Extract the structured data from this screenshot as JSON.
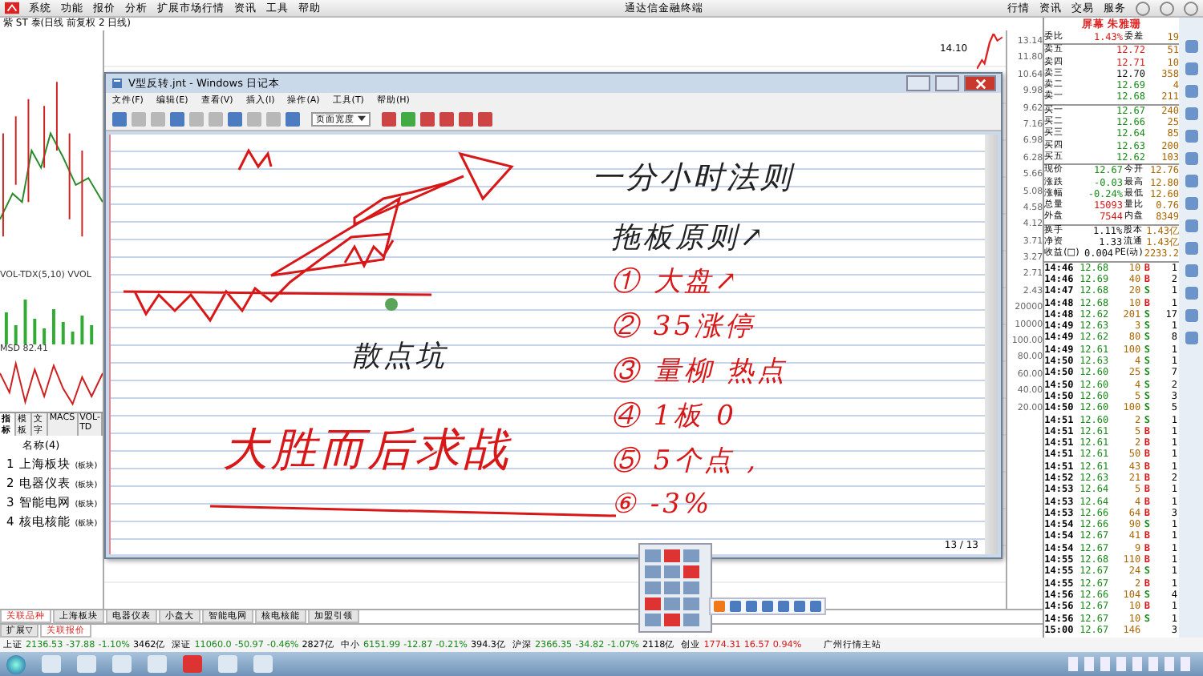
{
  "app": {
    "menu": [
      "系统",
      "功能",
      "报价",
      "分析",
      "扩展市场行情",
      "资讯",
      "工具",
      "帮助"
    ],
    "title": "通达信金融终端",
    "top_tabs": [
      "行情",
      "资讯",
      "交易",
      "服务"
    ],
    "chart_title": "紫 ST 泰(日线 前复权 2 日线)"
  },
  "chart": {
    "indicator_labels": [
      "VOL-TDX(5,10) VVOL",
      "MSD 82.41"
    ],
    "price_tag": "14.10",
    "axis_labels": [
      "13.14",
      "11.80",
      "10.64",
      "9.98",
      "9.62",
      "7.16",
      "6.98",
      "6.28",
      "5.66",
      "5.08",
      "4.58",
      "4.12",
      "3.71",
      "3.27",
      "2.71",
      "2.43",
      "20000",
      "10000",
      "100.00",
      "80.00",
      "60.00",
      "40.00",
      "20.00"
    ]
  },
  "left_panel": {
    "tabs": [
      {
        "label": "指标",
        "selected": true
      },
      {
        "label": "模板",
        "selected": false
      },
      {
        "label": "文字",
        "selected": false
      },
      {
        "label": "MACS",
        "selected": false
      },
      {
        "label": "VOL-TD",
        "selected": false
      }
    ],
    "header": "名称(4)",
    "items": [
      {
        "index": "1",
        "name": "上海板块",
        "tag": "(板块)"
      },
      {
        "index": "2",
        "name": "电器仪表",
        "tag": "(板块)"
      },
      {
        "index": "3",
        "name": "智能电网",
        "tag": "(板块)"
      },
      {
        "index": "4",
        "name": "核电核能",
        "tag": "(板块)"
      }
    ]
  },
  "bottom_tabs": [
    {
      "label": "关联品种",
      "selected": true
    },
    {
      "label": "上海板块",
      "selected": false
    },
    {
      "label": "电器仪表",
      "selected": false
    },
    {
      "label": "小盘大",
      "selected": false
    },
    {
      "label": "智能电网",
      "selected": false
    },
    {
      "label": "核电核能",
      "selected": false
    },
    {
      "label": "加盟引领",
      "selected": false
    }
  ],
  "sub_tabs": [
    {
      "label": "扩展▽",
      "selected": false
    },
    {
      "label": "关联报价",
      "selected": true
    }
  ],
  "quote_panel": {
    "title": "屏幕 朱雅珊",
    "book": [
      {
        "label": "委比",
        "value": "1.43%",
        "color": "#d81818",
        "label2": "委差",
        "value2": "19"
      },
      {
        "label": "卖五",
        "value": "12.72",
        "color": "#d81818",
        "value2": "51"
      },
      {
        "label": "卖四",
        "value": "12.71",
        "color": "#d81818",
        "value2": "10"
      },
      {
        "label": "卖三",
        "value": "12.70",
        "color": "#111111",
        "value2": "358"
      },
      {
        "label": "卖二",
        "value": "12.69",
        "color": "#1a8a1a",
        "value2": "4"
      },
      {
        "label": "卖一",
        "value": "12.68",
        "color": "#1a8a1a",
        "value2": "211"
      },
      {
        "label": "买一",
        "value": "12.67",
        "color": "#1a8a1a",
        "value2": "240"
      },
      {
        "label": "买二",
        "value": "12.66",
        "color": "#1a8a1a",
        "value2": "25"
      },
      {
        "label": "买三",
        "value": "12.64",
        "color": "#1a8a1a",
        "value2": "85"
      },
      {
        "label": "买四",
        "value": "12.63",
        "color": "#1a8a1a",
        "value2": "200"
      },
      {
        "label": "买五",
        "value": "12.62",
        "color": "#1a8a1a",
        "value2": "103"
      },
      {
        "label": "现价",
        "value": "12.67",
        "color": "#1a8a1a",
        "label2": "今开",
        "value2": "12.76"
      },
      {
        "label": "涨跌",
        "value": "-0.03",
        "color": "#1a8a1a",
        "label2": "最高",
        "value2": "12.80"
      },
      {
        "label": "涨幅",
        "value": "-0.24%",
        "color": "#1a8a1a",
        "label2": "最低",
        "value2": "12.60"
      },
      {
        "label": "总量",
        "value": "15093",
        "color": "#d81818",
        "label2": "量比",
        "value2": "0.76"
      },
      {
        "label": "外盘",
        "value": "7544",
        "color": "#d81818",
        "label2": "内盘",
        "value2": "8349"
      },
      {
        "label": "换手",
        "value": "1.11%",
        "color": "#111111",
        "label2": "股本",
        "value2": "1.43亿"
      },
      {
        "label": "净资",
        "value": "1.33",
        "color": "#111111",
        "label2": "流通",
        "value2": "1.43亿"
      },
      {
        "label": "收益(□)",
        "value": "0.004",
        "color": "#111111",
        "label2": "PE(动)",
        "value2": "2233.2"
      }
    ],
    "ticks": [
      {
        "time": "14:46",
        "price": "12.68",
        "volume": "10",
        "side": "B",
        "count": "1"
      },
      {
        "time": "14:46",
        "price": "12.69",
        "volume": "40",
        "side": "B",
        "count": "2"
      },
      {
        "time": "14:47",
        "price": "12.68",
        "volume": "20",
        "side": "S",
        "count": "1"
      },
      {
        "time": "14:48",
        "price": "12.68",
        "volume": "10",
        "side": "B",
        "count": "1"
      },
      {
        "time": "14:48",
        "price": "12.62",
        "volume": "201",
        "side": "S",
        "count": "17"
      },
      {
        "time": "14:49",
        "price": "12.63",
        "volume": "3",
        "side": "S",
        "count": "1"
      },
      {
        "time": "14:49",
        "price": "12.62",
        "volume": "80",
        "side": "S",
        "count": "8"
      },
      {
        "time": "14:49",
        "price": "12.61",
        "volume": "100",
        "side": "S",
        "count": "1"
      },
      {
        "time": "14:50",
        "price": "12.63",
        "volume": "4",
        "side": "S",
        "count": "1"
      },
      {
        "time": "14:50",
        "price": "12.60",
        "volume": "25",
        "side": "S",
        "count": "7"
      },
      {
        "time": "14:50",
        "price": "12.60",
        "volume": "4",
        "side": "S",
        "count": "2"
      },
      {
        "time": "14:50",
        "price": "12.60",
        "volume": "5",
        "side": "S",
        "count": "3"
      },
      {
        "time": "14:50",
        "price": "12.60",
        "volume": "100",
        "side": "S",
        "count": "5"
      },
      {
        "time": "14:51",
        "price": "12.60",
        "volume": "2",
        "side": "S",
        "count": "1"
      },
      {
        "time": "14:51",
        "price": "12.61",
        "volume": "5",
        "side": "B",
        "count": "1"
      },
      {
        "time": "14:51",
        "price": "12.61",
        "volume": "2",
        "side": "B",
        "count": "1"
      },
      {
        "time": "14:51",
        "price": "12.61",
        "volume": "50",
        "side": "B",
        "count": "1"
      },
      {
        "time": "14:51",
        "price": "12.61",
        "volume": "43",
        "side": "B",
        "count": "1"
      },
      {
        "time": "14:52",
        "price": "12.63",
        "volume": "21",
        "side": "B",
        "count": "2"
      },
      {
        "time": "14:53",
        "price": "12.64",
        "volume": "5",
        "side": "B",
        "count": "1"
      },
      {
        "time": "14:53",
        "price": "12.64",
        "volume": "4",
        "side": "B",
        "count": "1"
      },
      {
        "time": "14:53",
        "price": "12.66",
        "volume": "64",
        "side": "B",
        "count": "3"
      },
      {
        "time": "14:54",
        "price": "12.66",
        "volume": "90",
        "side": "S",
        "count": "1"
      },
      {
        "time": "14:54",
        "price": "12.67",
        "volume": "41",
        "side": "B",
        "count": "1"
      },
      {
        "time": "14:54",
        "price": "12.67",
        "volume": "9",
        "side": "B",
        "count": "1"
      },
      {
        "time": "14:55",
        "price": "12.68",
        "volume": "110",
        "side": "B",
        "count": "1"
      },
      {
        "time": "14:55",
        "price": "12.67",
        "volume": "24",
        "side": "S",
        "count": "1"
      },
      {
        "time": "14:55",
        "price": "12.67",
        "volume": "2",
        "side": "B",
        "count": "1"
      },
      {
        "time": "14:56",
        "price": "12.66",
        "volume": "104",
        "side": "S",
        "count": "4"
      },
      {
        "time": "14:56",
        "price": "12.67",
        "volume": "10",
        "side": "B",
        "count": "1"
      },
      {
        "time": "14:56",
        "price": "12.67",
        "volume": "10",
        "side": "S",
        "count": "1"
      },
      {
        "time": "15:00",
        "price": "12.67",
        "volume": "146",
        "count": "3"
      }
    ]
  },
  "index_bar": [
    {
      "name": "上证",
      "value": "2136.53",
      "change": "-37.88",
      "pct": "-1.10%",
      "amount": "3462亿",
      "color": "#1a8a1a"
    },
    {
      "name": "深证",
      "value": "11060.0",
      "change": "-50.97",
      "pct": "-0.46%",
      "amount": "2827亿",
      "color": "#1a8a1a"
    },
    {
      "name": "中小",
      "value": "6151.99",
      "change": "-12.87",
      "pct": "-0.21%",
      "amount": "394.3亿",
      "color": "#1a8a1a"
    },
    {
      "name": "沪深",
      "value": "2366.35",
      "change": "-34.82",
      "pct": "-1.07%",
      "amount": "2118亿",
      "color": "#1a8a1a"
    },
    {
      "name": "创业",
      "value": "1774.31",
      "change": "16.57",
      "pct": "0.94%",
      "color": "#d81818"
    }
  ],
  "server": "广州行情主站",
  "journal": {
    "title": "V型反转.jnt - Windows 日记本",
    "menu": [
      "文件(F)",
      "编辑(E)",
      "查看(V)",
      "插入(I)",
      "操作(A)",
      "工具(T)",
      "帮助(H)"
    ],
    "zoom": "页面宽度",
    "page_indicator": "13 / 13",
    "notes": [
      {
        "text": "一分小时法则",
        "color": "#222222",
        "kind": "title"
      },
      {
        "text": "拖板原则↗",
        "color": "#222222",
        "kind": "heading"
      },
      {
        "text": "① 大盘↗",
        "color": "#d81818",
        "kind": "item"
      },
      {
        "text": "② 35涨停",
        "color": "#d81818",
        "kind": "item"
      },
      {
        "text": "③ 量柳 热点",
        "color": "#d81818",
        "kind": "item"
      },
      {
        "text": "④ 1板 0",
        "color": "#d81818",
        "kind": "item"
      },
      {
        "text": "⑤ 5个点 ,",
        "color": "#d81818",
        "kind": "item"
      },
      {
        "text": "⑥ -3%",
        "color": "#d81818",
        "kind": "item"
      },
      {
        "text": "散点坑",
        "color": "#222222",
        "kind": "label"
      },
      {
        "text": "大胜而后求战",
        "color": "#d81818",
        "kind": "motto"
      }
    ]
  }
}
